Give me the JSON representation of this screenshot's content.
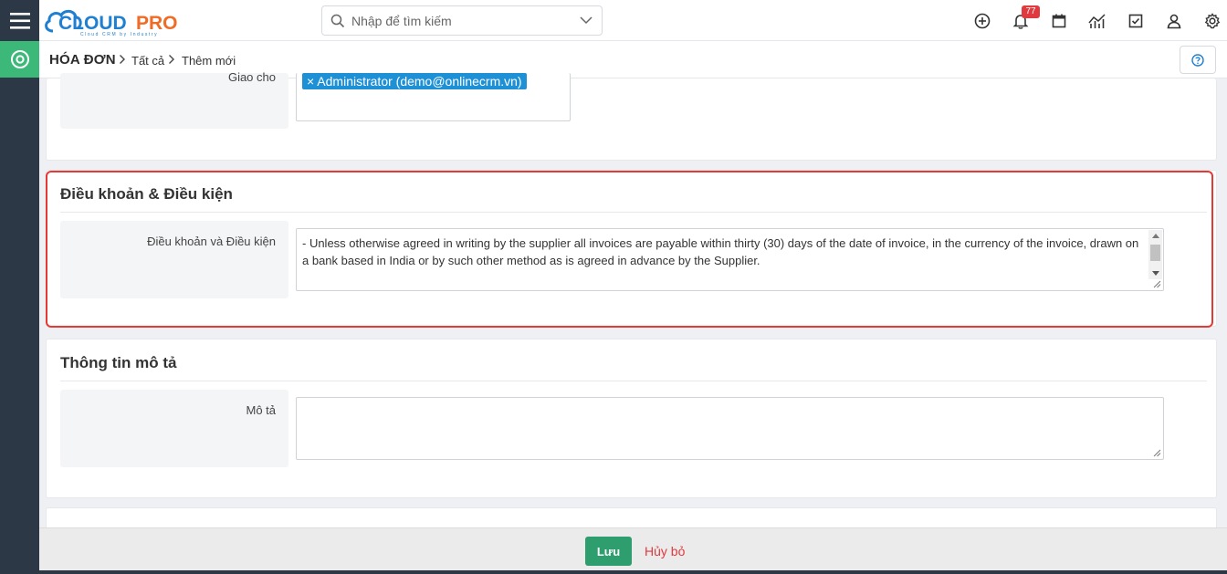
{
  "app": {
    "logo_text_cloud": "CLOUD",
    "logo_text_pro": "PRO",
    "logo_tagline": "Cloud CRM by Industry"
  },
  "search": {
    "placeholder": "Nhập để tìm kiếm"
  },
  "topbar": {
    "icons": [
      "plus-circle-icon",
      "bell-icon",
      "calendar-icon",
      "chart-icon",
      "checkbox-icon",
      "user-icon",
      "gear-icon"
    ],
    "notification_count": "77"
  },
  "breadcrumb": {
    "module": "HÓA ĐƠN",
    "all": "Tất cả",
    "current": "Thêm mới"
  },
  "assign_card": {
    "label": "Giao cho",
    "tag": "× Administrator (demo@onlinecrm.vn)"
  },
  "terms_card": {
    "title": "Điều khoản & Điều kiện",
    "field_label": "Điều khoản và Điều kiện",
    "field_value": " - Unless otherwise agreed in writing by the supplier all invoices are payable within thirty (30) days of the date of invoice, in the currency of the invoice, drawn on a bank based in India or by such other method as is agreed in advance by the Supplier."
  },
  "description_card": {
    "title": "Thông tin mô tả",
    "field_label": "Mô tả",
    "field_value": ""
  },
  "footer": {
    "save_label": "Lưu",
    "cancel_label": "Hủy bỏ"
  },
  "colors": {
    "sidebar": "#2c3845",
    "accent_green": "#3cb878",
    "save_button": "#2f9e6e",
    "cancel_text": "#e0393e",
    "highlight_border": "#e53935",
    "tag_blue": "#1e90d6",
    "logo_orange": "#ef6c27",
    "logo_blue": "#1f7fd0"
  }
}
